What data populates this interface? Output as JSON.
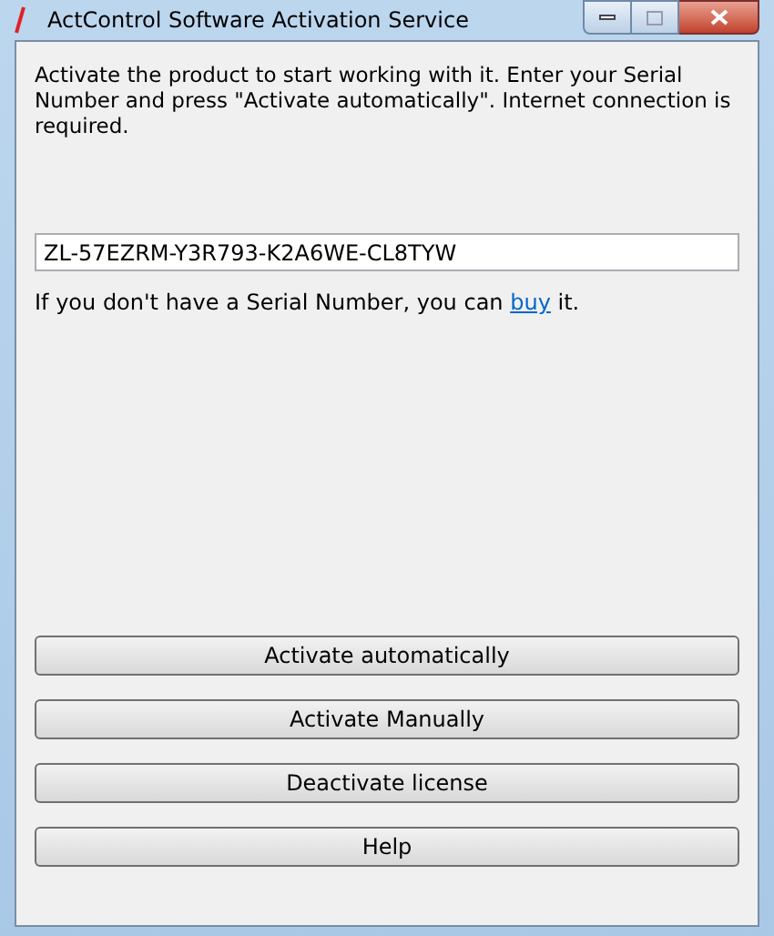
{
  "window": {
    "title": "ActControl Software Activation Service"
  },
  "intro": "Activate the product to start working with it. Enter your Serial Number and press \"Activate automatically\". Internet connection is required.",
  "serial_field": {
    "value": "ZL-57EZRM-Y3R793-K2A6WE-CL8TYW"
  },
  "hint": {
    "before": "If you don't have a Serial Number, you can ",
    "link": "buy",
    "after": " it."
  },
  "buttons": [
    "Activate automatically",
    "Activate Manually",
    "Deactivate license",
    "Help"
  ]
}
